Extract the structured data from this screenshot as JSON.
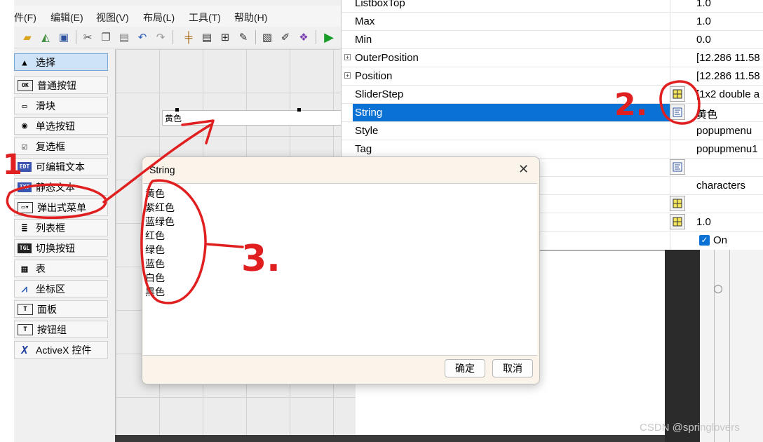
{
  "menubar": {
    "items": [
      "件(F)",
      "编辑(E)",
      "视图(V)",
      "布局(L)",
      "工具(T)",
      "帮助(H)"
    ]
  },
  "toolbar": {
    "icons": [
      "folder-open-icon",
      "new-file-icon",
      "save-icon",
      "cut-icon",
      "copy-icon",
      "paste-icon",
      "undo-icon",
      "redo-icon",
      "align-icon",
      "menu-editor-icon",
      "tab-order-icon",
      "editor-icon",
      "mfile-icon",
      "inspector-icon",
      "object-browser-icon",
      "run-icon"
    ]
  },
  "palette": {
    "items": [
      {
        "label": "选择",
        "icon": "▲"
      },
      {
        "label": "普通按钮",
        "icon": "OK"
      },
      {
        "label": "滑块",
        "icon": "▭"
      },
      {
        "label": "单选按钮",
        "icon": "◉"
      },
      {
        "label": "复选框",
        "icon": "☑"
      },
      {
        "label": "可编辑文本",
        "icon": "EDT"
      },
      {
        "label": "静态文本",
        "icon": "TXT"
      },
      {
        "label": "弹出式菜单",
        "icon": "▭▾"
      },
      {
        "label": "列表框",
        "icon": "≣"
      },
      {
        "label": "切换按钮",
        "icon": "TGL"
      },
      {
        "label": "表",
        "icon": "▦"
      },
      {
        "label": "坐标区",
        "icon": "⩘"
      },
      {
        "label": "面板",
        "icon": "T"
      },
      {
        "label": "按钮组",
        "icon": "T"
      },
      {
        "label": "ActiveX 控件",
        "icon": "X"
      }
    ]
  },
  "canvas": {
    "popup_text": "黄色"
  },
  "inspector": {
    "rows": [
      {
        "name": "ListboxTop",
        "value": "1.0"
      },
      {
        "name": "Max",
        "value": "1.0"
      },
      {
        "name": "Min",
        "value": "0.0"
      },
      {
        "name": "OuterPosition",
        "value": "[12.286 11.58",
        "expand": "+"
      },
      {
        "name": "Position",
        "value": "[12.286 11.58",
        "expand": "+"
      },
      {
        "name": "SliderStep",
        "value": "[1x2  double a"
      },
      {
        "name": "String",
        "value": "黄色"
      },
      {
        "name": "Style",
        "value": "popupmenu"
      },
      {
        "name": "Tag",
        "value": "popupmenu1"
      },
      {
        "name": "",
        "value": ""
      },
      {
        "name": "",
        "value": "characters"
      },
      {
        "name": "",
        "value": ""
      },
      {
        "name": "",
        "value": "1.0"
      },
      {
        "name": "",
        "value": "On"
      }
    ]
  },
  "dialog": {
    "title": "String",
    "lines": [
      "黄色",
      "紫红色",
      "蓝绿色",
      "红色",
      "绿色",
      "蓝色",
      "白色",
      "黑色"
    ],
    "ok_label": "确定",
    "cancel_label": "取消"
  },
  "annotations": {
    "label_1": "1",
    "label_2": "2.",
    "label_3": "3.",
    "color": "#e02020"
  },
  "watermark": "CSDN @springlovers"
}
